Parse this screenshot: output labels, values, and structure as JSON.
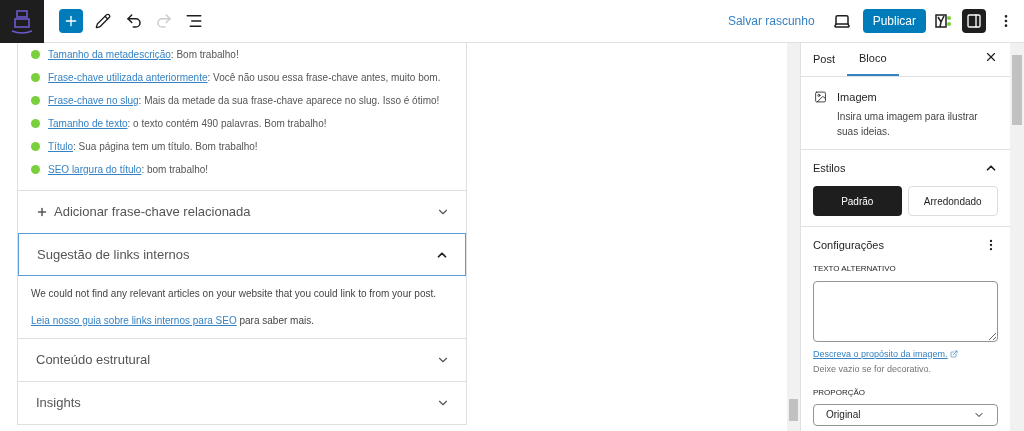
{
  "toolbar": {
    "save_draft": "Salvar rascunho",
    "publish": "Publicar"
  },
  "seo_checks": [
    {
      "link": "Tamanho da metadescrição",
      "text": ": Bom trabalho!",
      "color": "#7ad03a"
    },
    {
      "link": "Frase-chave utilizada anteriormente",
      "text": ": Você não usou essa frase-chave antes, muito bom.",
      "color": "#7ad03a"
    },
    {
      "link": "Frase-chave no slug",
      "text": ": Mais da metade da sua frase-chave aparece no slug. Isso é ótimo!",
      "color": "#7ad03a"
    },
    {
      "link": "Tamanho de texto",
      "text": ": o texto contém 490 palavras. Bom trabalho!",
      "color": "#7ad03a"
    },
    {
      "link": "Título",
      "text": ": Sua página tem um título. Bom trabalho!",
      "color": "#7ad03a"
    },
    {
      "link": "SEO largura do título",
      "text": ": bom trabalho!",
      "color": "#7ad03a"
    }
  ],
  "sections": [
    {
      "title": "Adicionar frase-chave relacionada",
      "kind": "add",
      "expanded": false
    },
    {
      "title": "Sugestão de links internos",
      "kind": "plain",
      "expanded": true,
      "body": "We could not find any relevant articles on your website that you could link to from your post.",
      "link": "Leia nosso guia sobre links internos para SEO",
      "after_link": "para saber mais."
    },
    {
      "title": "Conteúdo estrutural",
      "kind": "plain",
      "expanded": false
    },
    {
      "title": "Insights",
      "kind": "plain",
      "expanded": false
    }
  ],
  "sidebar": {
    "tabs": [
      {
        "label": "Post",
        "selected": false
      },
      {
        "label": "Bloco",
        "selected": true
      }
    ],
    "block": {
      "title": "Imagem",
      "description": "Insira uma imagem para ilustrar suas ideias."
    },
    "styles": {
      "title": "Estilos",
      "expanded": true,
      "options": [
        {
          "label": "Padrão",
          "selected": true
        },
        {
          "label": "Arredondado",
          "selected": false
        }
      ]
    },
    "settings": {
      "title": "Configurações",
      "alt_label": "TEXTO ALTERNATIVO",
      "help_link": "Descreva o propósito da imagem.",
      "help_text": "Deixe vazio se for decorativo.",
      "ratio_label": "PROPORÇÃO",
      "ratio_value": "Original"
    }
  }
}
